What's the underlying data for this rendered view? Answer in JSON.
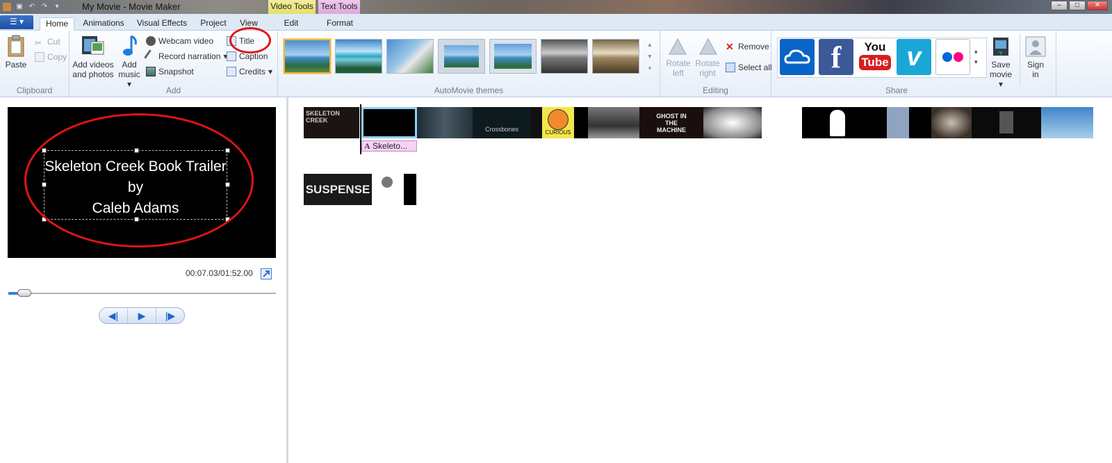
{
  "window": {
    "title": "My Movie - Movie Maker",
    "context_tabs": {
      "video_tools": "Video Tools",
      "text_tools": "Text Tools"
    },
    "controls": {
      "minimize": "–",
      "maximize": "□",
      "close": "✕"
    }
  },
  "tabs": [
    {
      "label": "Home",
      "active": true
    },
    {
      "label": "Animations"
    },
    {
      "label": "Visual Effects"
    },
    {
      "label": "Project"
    },
    {
      "label": "View"
    },
    {
      "label": "Edit"
    },
    {
      "label": "Format"
    }
  ],
  "ribbon": {
    "clipboard": {
      "label": "Clipboard",
      "paste": "Paste",
      "cut": "Cut",
      "copy": "Copy"
    },
    "add": {
      "label": "Add",
      "add_videos_line1": "Add videos",
      "add_videos_line2": "and photos",
      "add_music_line1": "Add",
      "add_music_line2": "music",
      "webcam": "Webcam video",
      "narration": "Record narration",
      "snapshot": "Snapshot",
      "title": "Title",
      "caption": "Caption",
      "credits": "Credits"
    },
    "themes": {
      "label": "AutoMovie themes",
      "count": 7,
      "selected_index": 0
    },
    "editing": {
      "label": "Editing",
      "rotate_left_1": "Rotate",
      "rotate_left_2": "left",
      "rotate_right_1": "Rotate",
      "rotate_right_2": "right",
      "remove": "Remove",
      "select_all": "Select all"
    },
    "share": {
      "label": "Share",
      "services": [
        "onedrive-icon",
        "facebook-icon",
        "youtube-icon",
        "vimeo-icon",
        "flickr-icon"
      ],
      "youtube_top": "You",
      "youtube_bottom": "Tube",
      "save_movie_1": "Save",
      "save_movie_2": "movie",
      "sign_in_1": "Sign",
      "sign_in_2": "in"
    }
  },
  "preview": {
    "title_line1": "Skeleton Creek Book Trailer",
    "title_line2": "by",
    "title_line3": "Caleb Adams",
    "timecode": "00:07.03/01:52.00",
    "progress": 0.06
  },
  "timeline": {
    "caption_clip": "Skeleto...",
    "clip_labels": [
      "SKELETON CREEK",
      "Crossbones",
      "CURIOUS",
      "GHOST IN THE MACHINE",
      "SUSPENSE"
    ]
  },
  "colors": {
    "accent": "#3b7de0",
    "highlight_ring": "#e01414",
    "ribbon_bg": "#e6eef8"
  }
}
